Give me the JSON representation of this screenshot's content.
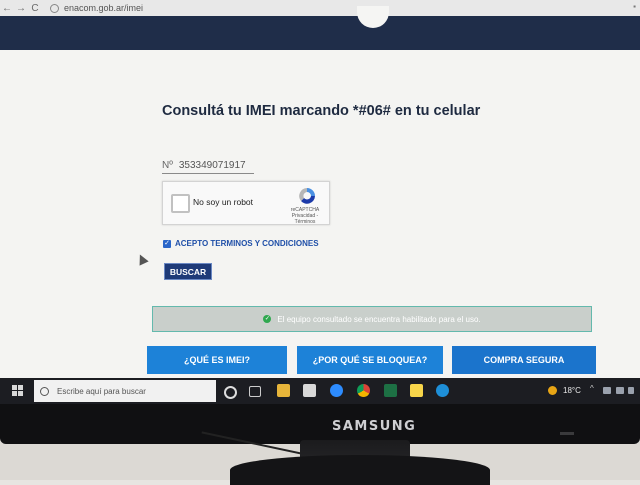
{
  "browser": {
    "back": "←",
    "forward": "→",
    "reload": "C",
    "url": "enacom.gob.ar/imei"
  },
  "page": {
    "title": "Consultá tu IMEI marcando *#06# en tu celular",
    "imei_field": {
      "prefix": "Nº",
      "value": "353349071917"
    },
    "captcha": {
      "label": "No soy un robot",
      "brand": "reCAPTCHA",
      "links": "Privacidad - Términos"
    },
    "terms": {
      "checked": true,
      "label": "ACEPTO TERMINOS Y CONDICIONES"
    },
    "search_button": "BUSCAR",
    "status_message": "El equipo consultado se encuentra habilitado para el uso.",
    "nav_buttons": [
      {
        "label": "¿QUÉ ES IMEI?"
      },
      {
        "label": "¿POR QUÉ SE BLOQUEA?"
      },
      {
        "label": "COMPRA SEGURA"
      }
    ]
  },
  "taskbar": {
    "search_placeholder": "Escribe aquí para buscar",
    "temperature": "18°C",
    "icons": [
      "cortana-icon",
      "task-view-icon",
      "file-explorer-icon",
      "calculator-icon",
      "zoom-icon",
      "chrome-icon",
      "excel-icon",
      "sticky-notes-icon",
      "app-icon"
    ]
  },
  "monitor": {
    "brand": "SAMSUNG"
  },
  "colors": {
    "header": "#1f2d49",
    "title": "#1e2a40",
    "nav_button": "#1d82d8",
    "status_bg": "#c9cfcb",
    "status_border": "#63b9ad",
    "checkbox": "#2a66c9"
  }
}
